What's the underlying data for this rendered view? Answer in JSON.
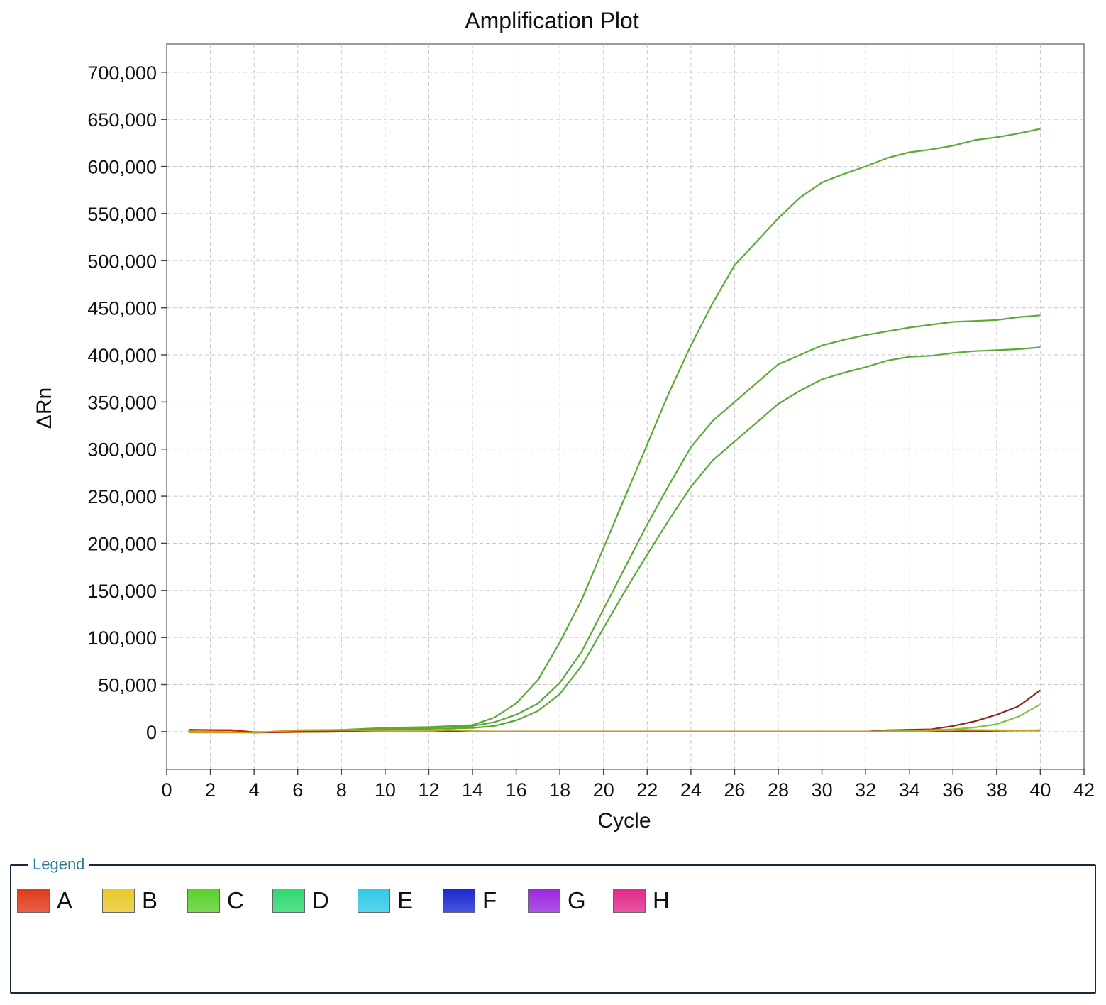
{
  "chart_data": {
    "type": "line",
    "title": "Amplification Plot",
    "xlabel": "Cycle",
    "ylabel": "ΔRn",
    "xlim": [
      0,
      42
    ],
    "ylim": [
      -40000,
      730000
    ],
    "xticks": [
      0,
      2,
      4,
      6,
      8,
      10,
      12,
      14,
      16,
      18,
      20,
      22,
      24,
      26,
      28,
      30,
      32,
      34,
      36,
      38,
      40,
      42
    ],
    "xtick_labels": [
      "0",
      "2",
      "4",
      "6",
      "8",
      "10",
      "12",
      "14",
      "16",
      "18",
      "20",
      "22",
      "24",
      "26",
      "28",
      "30",
      "32",
      "34",
      "36",
      "38",
      "40",
      "42"
    ],
    "yticks": [
      0,
      50000,
      100000,
      150000,
      200000,
      250000,
      300000,
      350000,
      400000,
      450000,
      500000,
      550000,
      600000,
      650000,
      700000
    ],
    "ytick_labels": [
      "0",
      "50,000",
      "100,000",
      "150,000",
      "200,000",
      "250,000",
      "300,000",
      "350,000",
      "400,000",
      "450,000",
      "500,000",
      "550,000",
      "600,000",
      "650,000",
      "700,000"
    ],
    "grid": true,
    "series": [
      {
        "color": "#5aaa38",
        "points": [
          [
            1,
            0
          ],
          [
            4,
            -1000
          ],
          [
            6,
            500
          ],
          [
            8,
            2000
          ],
          [
            10,
            4000
          ],
          [
            12,
            5000
          ],
          [
            14,
            7000
          ],
          [
            15,
            15000
          ],
          [
            16,
            30000
          ],
          [
            17,
            55000
          ],
          [
            18,
            95000
          ],
          [
            19,
            140000
          ],
          [
            20,
            195000
          ],
          [
            21,
            250000
          ],
          [
            22,
            305000
          ],
          [
            23,
            360000
          ],
          [
            24,
            410000
          ],
          [
            25,
            455000
          ],
          [
            26,
            495000
          ],
          [
            27,
            520000
          ],
          [
            28,
            545000
          ],
          [
            29,
            567000
          ],
          [
            30,
            583000
          ],
          [
            31,
            592000
          ],
          [
            32,
            600000
          ],
          [
            33,
            609000
          ],
          [
            34,
            615000
          ],
          [
            35,
            618000
          ],
          [
            36,
            622000
          ],
          [
            37,
            628000
          ],
          [
            38,
            631000
          ],
          [
            39,
            635000
          ],
          [
            40,
            640000
          ]
        ]
      },
      {
        "color": "#5aaa38",
        "points": [
          [
            1,
            0
          ],
          [
            4,
            -1000
          ],
          [
            6,
            200
          ],
          [
            8,
            1500
          ],
          [
            10,
            3000
          ],
          [
            12,
            4500
          ],
          [
            14,
            6000
          ],
          [
            15,
            10000
          ],
          [
            16,
            18000
          ],
          [
            17,
            30000
          ],
          [
            18,
            52000
          ],
          [
            19,
            85000
          ],
          [
            20,
            130000
          ],
          [
            21,
            175000
          ],
          [
            22,
            220000
          ],
          [
            23,
            262000
          ],
          [
            24,
            302000
          ],
          [
            25,
            330000
          ],
          [
            26,
            350000
          ],
          [
            27,
            370000
          ],
          [
            28,
            390000
          ],
          [
            29,
            400000
          ],
          [
            30,
            410000
          ],
          [
            31,
            416000
          ],
          [
            32,
            421000
          ],
          [
            33,
            425000
          ],
          [
            34,
            429000
          ],
          [
            35,
            432000
          ],
          [
            36,
            435000
          ],
          [
            37,
            436000
          ],
          [
            38,
            437000
          ],
          [
            39,
            440000
          ],
          [
            40,
            442000
          ]
        ]
      },
      {
        "color": "#5aaa38",
        "points": [
          [
            1,
            0
          ],
          [
            4,
            -1000
          ],
          [
            6,
            0
          ],
          [
            8,
            1000
          ],
          [
            10,
            2000
          ],
          [
            12,
            3000
          ],
          [
            14,
            4000
          ],
          [
            15,
            6000
          ],
          [
            16,
            12000
          ],
          [
            17,
            22000
          ],
          [
            18,
            40000
          ],
          [
            19,
            70000
          ],
          [
            20,
            110000
          ],
          [
            21,
            150000
          ],
          [
            22,
            188000
          ],
          [
            23,
            225000
          ],
          [
            24,
            260000
          ],
          [
            25,
            288000
          ],
          [
            26,
            308000
          ],
          [
            27,
            328000
          ],
          [
            28,
            348000
          ],
          [
            29,
            362000
          ],
          [
            30,
            374000
          ],
          [
            31,
            381000
          ],
          [
            32,
            387000
          ],
          [
            33,
            394000
          ],
          [
            34,
            398000
          ],
          [
            35,
            399000
          ],
          [
            36,
            402000
          ],
          [
            37,
            404000
          ],
          [
            38,
            405000
          ],
          [
            39,
            406000
          ],
          [
            40,
            408000
          ]
        ]
      },
      {
        "color": "#8b2a1a",
        "points": [
          [
            1,
            2000
          ],
          [
            3,
            1500
          ],
          [
            4,
            -1000
          ],
          [
            8,
            0
          ],
          [
            12,
            0
          ],
          [
            16,
            0
          ],
          [
            20,
            0
          ],
          [
            24,
            0
          ],
          [
            26,
            0
          ],
          [
            30,
            0
          ],
          [
            32,
            0
          ],
          [
            33,
            1500
          ],
          [
            35,
            2500
          ],
          [
            36,
            6000
          ],
          [
            37,
            11000
          ],
          [
            38,
            18000
          ],
          [
            39,
            27000
          ],
          [
            40,
            44000
          ]
        ]
      },
      {
        "color": "#7ac838",
        "points": [
          [
            1,
            0
          ],
          [
            4,
            -500
          ],
          [
            8,
            0
          ],
          [
            12,
            0
          ],
          [
            16,
            0
          ],
          [
            20,
            0
          ],
          [
            24,
            0
          ],
          [
            28,
            0
          ],
          [
            32,
            0
          ],
          [
            34,
            1000
          ],
          [
            36,
            2500
          ],
          [
            37,
            4500
          ],
          [
            38,
            8000
          ],
          [
            39,
            16000
          ],
          [
            40,
            29000
          ]
        ]
      },
      {
        "color": "#cc2200",
        "points": [
          [
            1,
            2000
          ],
          [
            3,
            1500
          ],
          [
            4,
            -500
          ],
          [
            8,
            0
          ],
          [
            12,
            0
          ],
          [
            16,
            0
          ],
          [
            20,
            0
          ],
          [
            24,
            0
          ],
          [
            28,
            0
          ],
          [
            32,
            0
          ],
          [
            36,
            0
          ],
          [
            38,
            1000
          ],
          [
            40,
            1500
          ]
        ]
      },
      {
        "color": "#c8a020",
        "points": [
          [
            1,
            -1000
          ],
          [
            4,
            -1000
          ],
          [
            6,
            1500
          ],
          [
            8,
            2000
          ],
          [
            10,
            500
          ],
          [
            12,
            500
          ],
          [
            13,
            2000
          ],
          [
            14,
            500
          ],
          [
            16,
            0
          ],
          [
            20,
            0
          ],
          [
            24,
            0
          ],
          [
            28,
            0
          ],
          [
            34,
            0
          ],
          [
            36,
            2000
          ],
          [
            38,
            1500
          ],
          [
            40,
            1000
          ]
        ]
      }
    ]
  },
  "legend": {
    "title": "Legend",
    "items": [
      {
        "label": "A",
        "color": "#e03a1a"
      },
      {
        "label": "B",
        "color": "#e8c82a"
      },
      {
        "label": "C",
        "color": "#5ad02a"
      },
      {
        "label": "D",
        "color": "#2ed870"
      },
      {
        "label": "E",
        "color": "#30c8e8"
      },
      {
        "label": "F",
        "color": "#1a2ad0"
      },
      {
        "label": "G",
        "color": "#9a28e0"
      },
      {
        "label": "H",
        "color": "#e02a8a"
      }
    ]
  }
}
